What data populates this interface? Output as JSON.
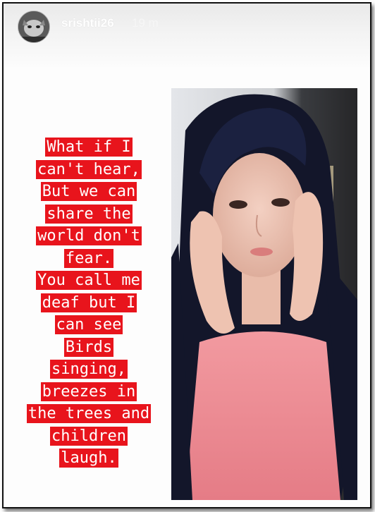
{
  "story": {
    "username": "srishtii26",
    "timestamp": "19 m"
  },
  "poem": {
    "lines": [
      "What if I",
      "can't hear,",
      "But we can",
      "share the",
      "world don't",
      "fear.",
      "You call me",
      "deaf but I",
      "can see",
      "Birds",
      "singing,",
      "breezes in",
      "the trees and",
      "children",
      "laugh."
    ],
    "highlight_color": "#e8141c",
    "text_color": "#ffffff"
  },
  "photo": {
    "icon": "portrait-photo"
  }
}
